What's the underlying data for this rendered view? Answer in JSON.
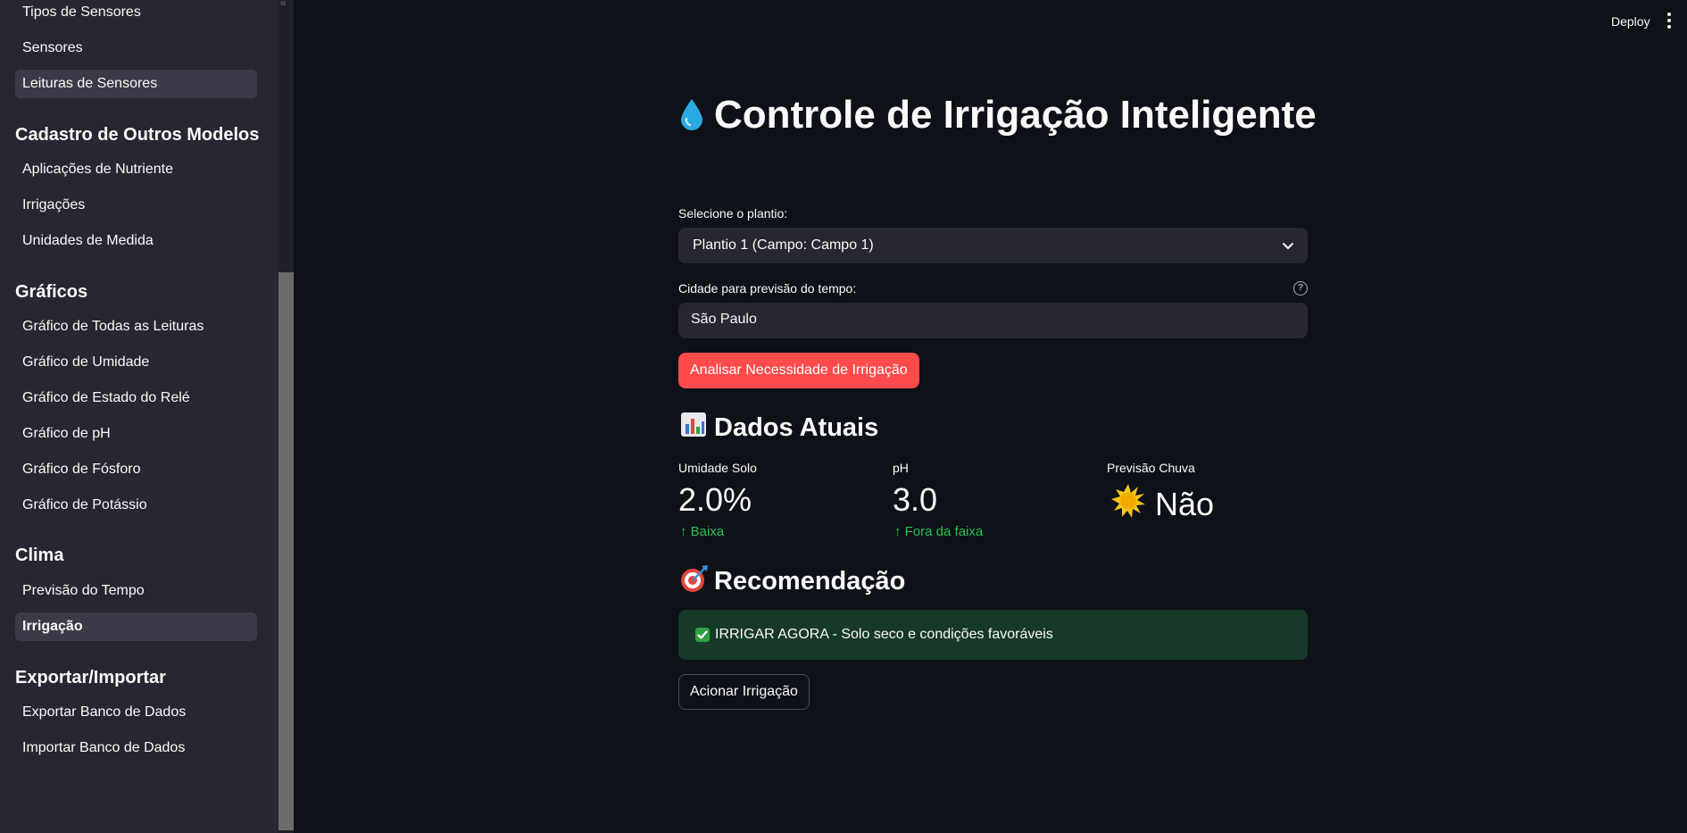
{
  "sidebar": {
    "items_top": [
      {
        "label": "Tipos de Sensores",
        "active": false
      },
      {
        "label": "Sensores",
        "active": false
      },
      {
        "label": "Leituras de Sensores",
        "active": true
      }
    ],
    "groups": [
      {
        "title": "Cadastro de Outros Modelos",
        "items": [
          "Aplicações de Nutriente",
          "Irrigações",
          "Unidades de Medida"
        ]
      },
      {
        "title": "Gráficos",
        "items": [
          "Gráfico de Todas as Leituras",
          "Gráfico de Umidade",
          "Gráfico de Estado do Relé",
          "Gráfico de pH",
          "Gráfico de Fósforo",
          "Gráfico de Potássio"
        ]
      },
      {
        "title": "Clima",
        "items": [
          "Previsão do Tempo",
          "Irrigação"
        ]
      },
      {
        "title": "Exportar/Importar",
        "items": [
          "Exportar Banco de Dados",
          "Importar Banco de Dados"
        ]
      }
    ],
    "collapse_icon": "double-chevron-left-icon"
  },
  "header": {
    "deploy_label": "Deploy",
    "menu_icon": "kebab-menu-icon"
  },
  "main": {
    "title": "Controle de Irrigação Inteligente",
    "title_icon": "droplet-icon",
    "plantio_label": "Selecione o plantio:",
    "plantio_value": "Plantio 1 (Campo: Campo 1)",
    "cidade_label": "Cidade para previsão do tempo:",
    "cidade_value": "São Paulo",
    "analyze_button": "Analisar Necessidade de Irrigação",
    "dados_heading": "Dados Atuais",
    "dados_icon": "bar-chart-icon",
    "metrics": [
      {
        "label": "Umidade Solo",
        "value": "2.0%",
        "delta": "Baixa"
      },
      {
        "label": "pH",
        "value": "3.0",
        "delta": "Fora da faixa"
      },
      {
        "label": "Previsão Chuva",
        "value": "Não",
        "icon": "sun-icon"
      }
    ],
    "recomendacao_heading": "Recomendação",
    "recomendacao_icon": "target-icon",
    "recomendacao_msg": "IRRIGAR AGORA - Solo seco e condições favoráveis",
    "action_button": "Acionar Irrigação"
  },
  "colors": {
    "background": "#0e1117",
    "sidebar": "#262730",
    "primary": "#ff4b4b",
    "delta_positive": "#21c354",
    "success_bg": "#173928"
  }
}
